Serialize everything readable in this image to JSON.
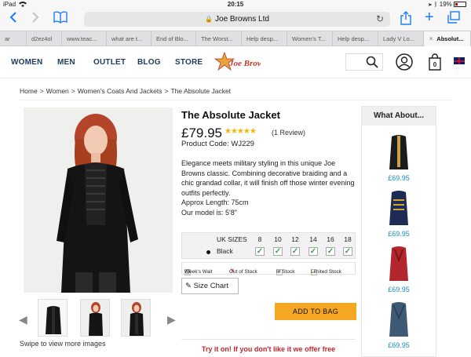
{
  "status_bar": {
    "carrier": "iPad",
    "time": "20:15",
    "battery": "19%"
  },
  "browser": {
    "url_text": "Joe Browns Ltd",
    "tabs": [
      {
        "label": "ar"
      },
      {
        "label": "d2ez4ol"
      },
      {
        "label": "www.teac..."
      },
      {
        "label": "what are t..."
      },
      {
        "label": "End of Blo..."
      },
      {
        "label": "The Worst..."
      },
      {
        "label": "Help desp..."
      },
      {
        "label": "Women's T..."
      },
      {
        "label": "Help desp..."
      },
      {
        "label": "Lady V Lo..."
      },
      {
        "label": "Absolut..."
      }
    ]
  },
  "nav": {
    "women": "WOMEN",
    "men": "MEN",
    "outlet": "OUTLET",
    "blog": "BLOG",
    "store": "STORE",
    "logo_text": "Joe Browns",
    "bag_count": "0"
  },
  "breadcrumb": {
    "home": "Home",
    "women": "Women",
    "category": "Women's Coats And Jackets",
    "current": "The Absolute Jacket",
    "sep": ">"
  },
  "product": {
    "title": "The Absolute Jacket",
    "price": "£79.95",
    "rating": 5,
    "stars": "★★★★★",
    "reviews": "(1 Review)",
    "code": "Product Code: WJ229",
    "desc_1": "Elegance meets military styling in this unique Joe Browns classic. Combining decorative braiding and a chic grandad collar, it will finish off those winter evening outfits perfectly.",
    "desc_2": "Approx Length: 75cm",
    "desc_3": "Our model is: 5'8\"",
    "sizes_label": "UK SIZES",
    "sizes": [
      "8",
      "10",
      "12",
      "14",
      "16",
      "18"
    ],
    "colour": "Black",
    "legend": {
      "weeks_wait": "Week's Wait",
      "out_of_stock": "Out of Stock",
      "in_stock": "In Stock",
      "limited_stock": "Limited Stock"
    },
    "size_chart": "Size Chart",
    "add_to_bag": "ADD TO BAG",
    "try_on": "Try it on! If you don't like it we offer free",
    "swipe_text": "Swipe to view more images"
  },
  "what_about": {
    "heading": "What About...",
    "items": [
      {
        "price": "£69.95",
        "color": "#1c1c1c"
      },
      {
        "price": "£69.95",
        "color": "#1d2b55"
      },
      {
        "price": "£69.95",
        "color": "#b3262d"
      },
      {
        "price": "£69.95",
        "color": "#3f5a74"
      }
    ]
  },
  "colors": {
    "accent_orange": "#f5a623",
    "nav_blue": "#1f3a5c",
    "price_blue": "#1a8fbf",
    "promo_red": "#c1272d",
    "check_green": "#41a341"
  }
}
